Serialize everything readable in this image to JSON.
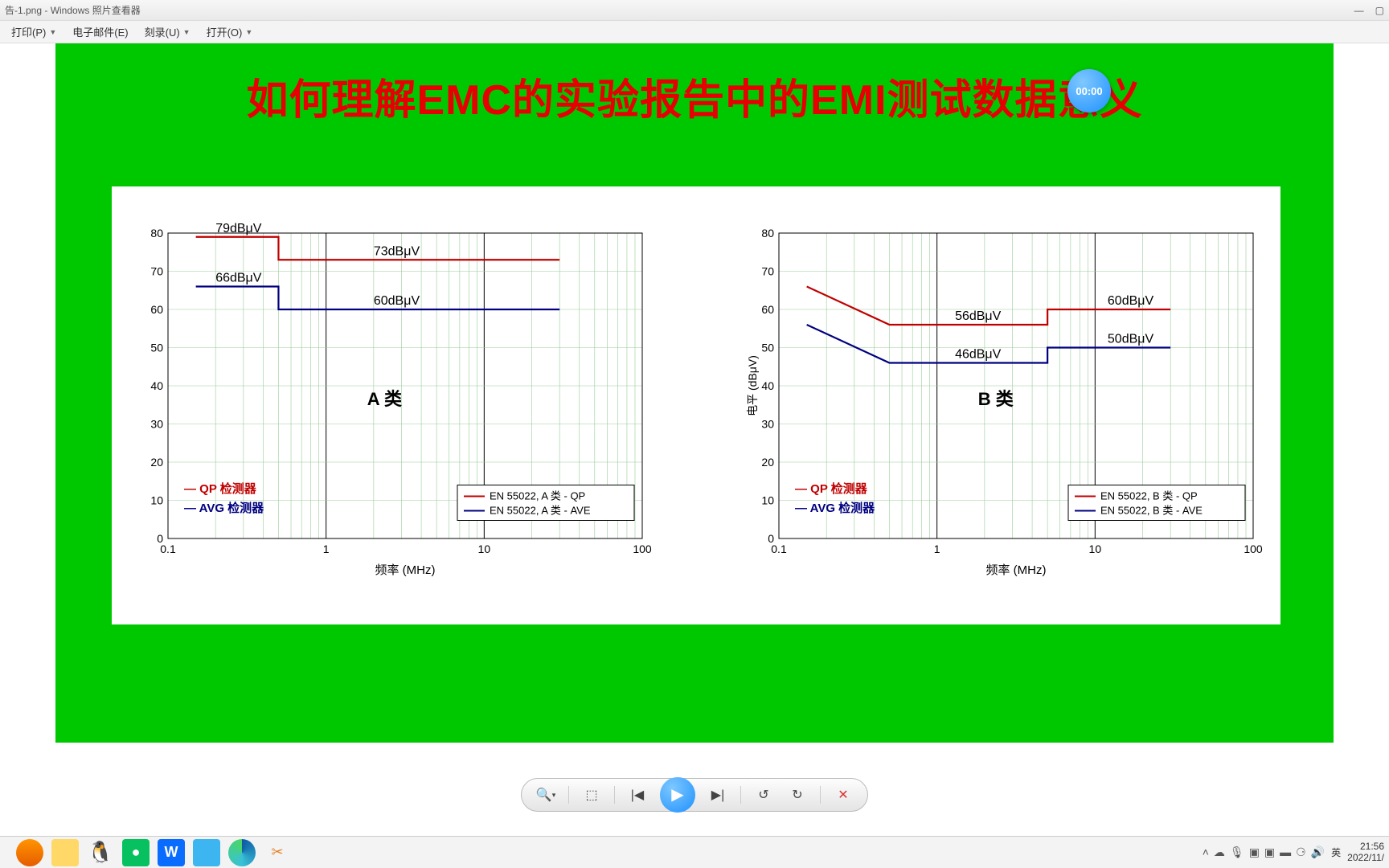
{
  "window": {
    "title": "告-1.png - Windows 照片查看器",
    "min": "—",
    "max": "▢"
  },
  "menu": {
    "print": "打印(P)",
    "email": "电子邮件(E)",
    "burn": "刻录(U)",
    "open": "打开(O)"
  },
  "timer": "00:00",
  "slide": {
    "heading": "如何理解EMC的实验报告中的EMI测试数据意义"
  },
  "toolbar": {
    "zoom": "🔍",
    "fit": "⬚",
    "prev": "|◀",
    "play": "▶",
    "next": "▶|",
    "ccw": "↺",
    "cw": "↻",
    "del": "✕"
  },
  "chart_data": [
    {
      "type": "line",
      "title": "A 类",
      "xlabel": "频率 (MHz)",
      "ylabel": "",
      "xscale": "log",
      "xlim": [
        0.1,
        100
      ],
      "ylim": [
        0,
        80
      ],
      "yticks": [
        0,
        10,
        20,
        30,
        40,
        50,
        60,
        70,
        80
      ],
      "xticks": [
        0.1,
        1,
        10,
        100
      ],
      "series": [
        {
          "name": "EN 55022, A 类 - QP",
          "color": "#c00000",
          "points": [
            [
              0.15,
              79
            ],
            [
              0.5,
              79
            ],
            [
              0.5,
              73
            ],
            [
              30,
              73
            ]
          ],
          "labels": [
            "79dBμV",
            "73dBμV"
          ]
        },
        {
          "name": "EN 55022, A 类 - AVE",
          "color": "#000080",
          "points": [
            [
              0.15,
              66
            ],
            [
              0.5,
              66
            ],
            [
              0.5,
              60
            ],
            [
              30,
              60
            ]
          ],
          "labels": [
            "66dBμV",
            "60dBμV"
          ]
        }
      ],
      "legend_inside": [
        "— QP 检测器",
        "— AVG 检测器"
      ]
    },
    {
      "type": "line",
      "title": "B 类",
      "xlabel": "频率 (MHz)",
      "ylabel": "电平 (dBμV)",
      "xscale": "log",
      "xlim": [
        0.1,
        100
      ],
      "ylim": [
        0,
        80
      ],
      "yticks": [
        0,
        10,
        20,
        30,
        40,
        50,
        60,
        70,
        80
      ],
      "xticks": [
        0.1,
        1,
        10,
        100
      ],
      "series": [
        {
          "name": "EN 55022, B 类 - QP",
          "color": "#c00000",
          "points": [
            [
              0.15,
              66
            ],
            [
              0.5,
              56
            ],
            [
              5,
              56
            ],
            [
              5,
              60
            ],
            [
              30,
              60
            ]
          ],
          "labels": [
            "56dBμV",
            "60dBμV"
          ]
        },
        {
          "name": "EN 55022, B 类 - AVE",
          "color": "#000080",
          "points": [
            [
              0.15,
              56
            ],
            [
              0.5,
              46
            ],
            [
              5,
              46
            ],
            [
              5,
              50
            ],
            [
              30,
              50
            ]
          ],
          "labels": [
            "46dBμV",
            "50dBμV"
          ]
        }
      ],
      "legend_inside": [
        "— QP 检测器",
        "— AVG 检测器"
      ]
    }
  ],
  "taskbar": {
    "time": "21:56",
    "date": "2022/11/",
    "ime": "英"
  }
}
